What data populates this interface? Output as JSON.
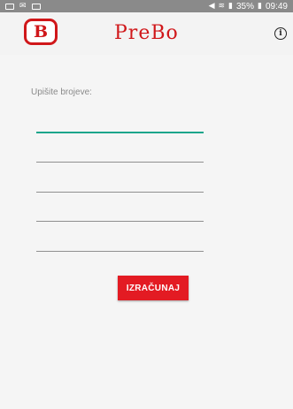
{
  "status_bar": {
    "left_icons": [
      "image-icon",
      "notification-icon",
      "screenshot-icon"
    ],
    "right_glyphs": [
      "mute-icon",
      "wifi-icon",
      "signal-icon"
    ],
    "battery": "35%",
    "time": "09:49"
  },
  "app_bar": {
    "logo_mark": "B",
    "title": "PreBo",
    "info_icon": "info-icon",
    "info_glyph": "i"
  },
  "form": {
    "prompt": "Upišite brojeve:",
    "fields": [
      {
        "value": "",
        "placeholder": ""
      },
      {
        "value": "",
        "placeholder": ""
      },
      {
        "value": "",
        "placeholder": ""
      },
      {
        "value": "",
        "placeholder": ""
      },
      {
        "value": "",
        "placeholder": ""
      }
    ],
    "calculate_label": "IZRAČUNAJ"
  },
  "colors": {
    "brand_red": "#d0171a",
    "button_red": "#e31b23",
    "focus_teal": "#1aa58b",
    "status_bar": "#8a8a8a"
  }
}
